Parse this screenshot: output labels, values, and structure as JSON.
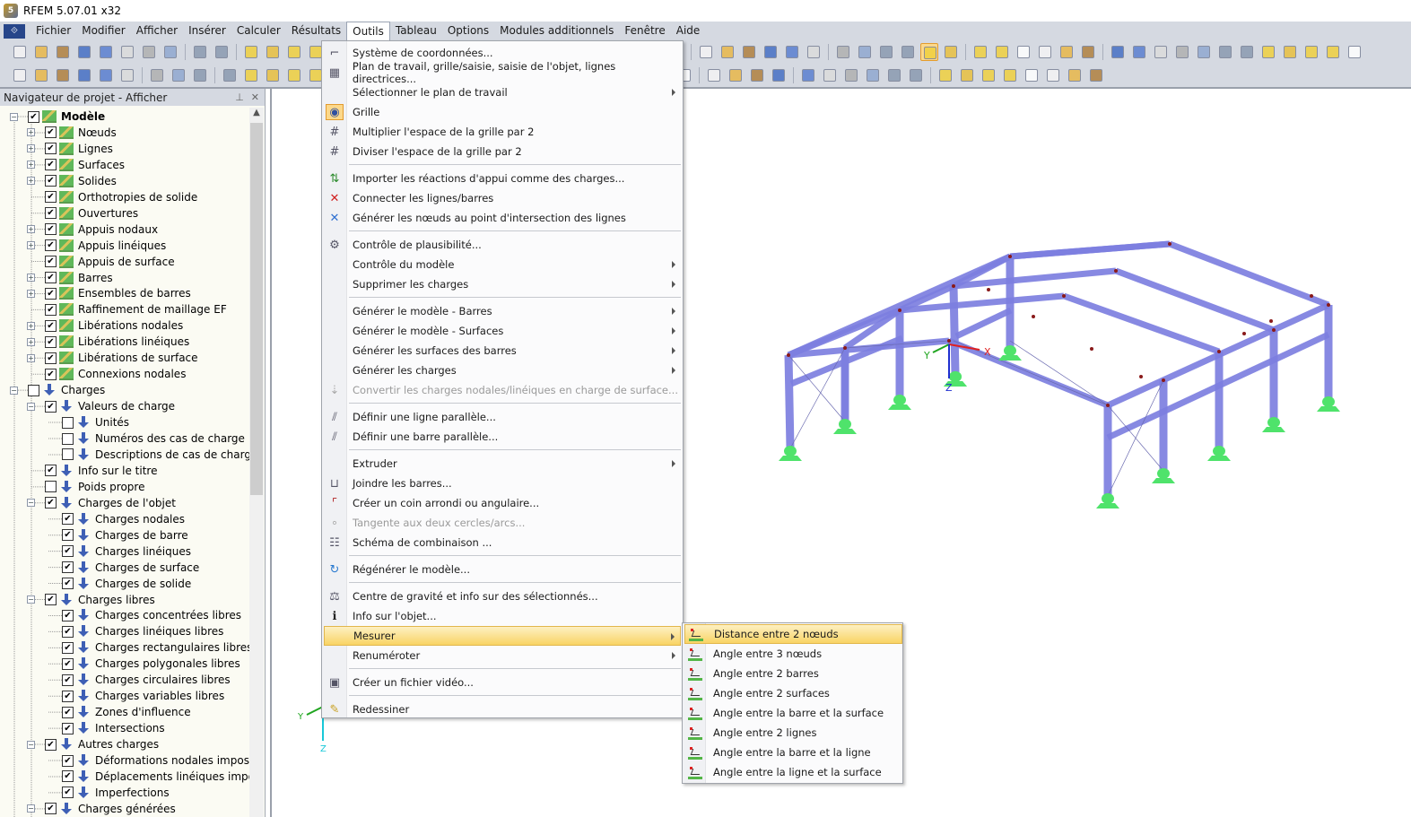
{
  "window": {
    "title": "RFEM 5.07.01 x32"
  },
  "menubar": {
    "items": [
      "Fichier",
      "Modifier",
      "Afficher",
      "Insérer",
      "Calculer",
      "Résultats",
      "Outils",
      "Tableau",
      "Options",
      "Modules additionnels",
      "Fenêtre",
      "Aide"
    ],
    "active": "Outils"
  },
  "navigator": {
    "title": "Navigateur de projet - Afficher",
    "pin_icon": "pin-icon",
    "close_icon": "close-icon",
    "tree": [
      {
        "label": "Modèle",
        "level": 0,
        "expander": "minus",
        "checked": true,
        "icon": "model-icon",
        "bold": true
      },
      {
        "label": "Nœuds",
        "level": 1,
        "expander": "plus",
        "checked": true,
        "icon": "model-icon"
      },
      {
        "label": "Lignes",
        "level": 1,
        "expander": "plus",
        "checked": true,
        "icon": "model-icon"
      },
      {
        "label": "Surfaces",
        "level": 1,
        "expander": "plus",
        "checked": true,
        "icon": "model-icon"
      },
      {
        "label": "Solides",
        "level": 1,
        "expander": "plus",
        "checked": true,
        "icon": "model-icon"
      },
      {
        "label": "Orthotropies de solide",
        "level": 1,
        "expander": "none",
        "checked": true,
        "icon": "model-icon"
      },
      {
        "label": "Ouvertures",
        "level": 1,
        "expander": "none",
        "checked": true,
        "icon": "model-icon"
      },
      {
        "label": "Appuis nodaux",
        "level": 1,
        "expander": "plus",
        "checked": true,
        "icon": "model-icon"
      },
      {
        "label": "Appuis linéiques",
        "level": 1,
        "expander": "plus",
        "checked": true,
        "icon": "model-icon"
      },
      {
        "label": "Appuis de surface",
        "level": 1,
        "expander": "none",
        "checked": true,
        "icon": "model-icon"
      },
      {
        "label": "Barres",
        "level": 1,
        "expander": "plus",
        "checked": true,
        "icon": "model-icon"
      },
      {
        "label": "Ensembles de barres",
        "level": 1,
        "expander": "plus",
        "checked": true,
        "icon": "model-icon"
      },
      {
        "label": "Raffinement de maillage EF",
        "level": 1,
        "expander": "none",
        "checked": true,
        "icon": "model-icon"
      },
      {
        "label": "Libérations nodales",
        "level": 1,
        "expander": "plus",
        "checked": true,
        "icon": "model-icon"
      },
      {
        "label": "Libérations linéiques",
        "level": 1,
        "expander": "plus",
        "checked": true,
        "icon": "model-icon"
      },
      {
        "label": "Libérations de surface",
        "level": 1,
        "expander": "plus",
        "checked": true,
        "icon": "model-icon"
      },
      {
        "label": "Connexions nodales",
        "level": 1,
        "expander": "none",
        "checked": true,
        "icon": "model-icon"
      },
      {
        "label": "Charges",
        "level": 0,
        "expander": "minus",
        "checked": false,
        "icon": "load-icon"
      },
      {
        "label": "Valeurs de charge",
        "level": 1,
        "expander": "minus",
        "checked": true,
        "icon": "load-icon"
      },
      {
        "label": "Unités",
        "level": 2,
        "expander": "none",
        "checked": false,
        "icon": "load-icon"
      },
      {
        "label": "Numéros des cas de charge",
        "level": 2,
        "expander": "none",
        "checked": false,
        "icon": "load-icon"
      },
      {
        "label": "Descriptions de cas de charge",
        "level": 2,
        "expander": "none",
        "checked": false,
        "icon": "load-icon"
      },
      {
        "label": "Info sur le titre",
        "level": 1,
        "expander": "none",
        "checked": true,
        "icon": "load-icon"
      },
      {
        "label": "Poids propre",
        "level": 1,
        "expander": "none",
        "checked": false,
        "icon": "load-icon"
      },
      {
        "label": "Charges de l'objet",
        "level": 1,
        "expander": "minus",
        "checked": true,
        "icon": "load-icon"
      },
      {
        "label": "Charges nodales",
        "level": 2,
        "expander": "none",
        "checked": true,
        "icon": "load-icon"
      },
      {
        "label": "Charges de barre",
        "level": 2,
        "expander": "none",
        "checked": true,
        "icon": "load-icon"
      },
      {
        "label": "Charges linéiques",
        "level": 2,
        "expander": "none",
        "checked": true,
        "icon": "load-icon"
      },
      {
        "label": "Charges de surface",
        "level": 2,
        "expander": "none",
        "checked": true,
        "icon": "load-icon"
      },
      {
        "label": "Charges de solide",
        "level": 2,
        "expander": "none",
        "checked": true,
        "icon": "load-icon"
      },
      {
        "label": "Charges libres",
        "level": 1,
        "expander": "minus",
        "checked": true,
        "icon": "load-icon"
      },
      {
        "label": "Charges concentrées libres",
        "level": 2,
        "expander": "none",
        "checked": true,
        "icon": "load-icon"
      },
      {
        "label": "Charges linéiques libres",
        "level": 2,
        "expander": "none",
        "checked": true,
        "icon": "load-icon"
      },
      {
        "label": "Charges rectangulaires libres",
        "level": 2,
        "expander": "none",
        "checked": true,
        "icon": "load-icon"
      },
      {
        "label": "Charges polygonales libres",
        "level": 2,
        "expander": "none",
        "checked": true,
        "icon": "load-icon"
      },
      {
        "label": "Charges circulaires libres",
        "level": 2,
        "expander": "none",
        "checked": true,
        "icon": "load-icon"
      },
      {
        "label": "Charges variables libres",
        "level": 2,
        "expander": "none",
        "checked": true,
        "icon": "load-icon"
      },
      {
        "label": "Zones d'influence",
        "level": 2,
        "expander": "none",
        "checked": true,
        "icon": "load-icon"
      },
      {
        "label": "Intersections",
        "level": 2,
        "expander": "none",
        "checked": true,
        "icon": "load-icon"
      },
      {
        "label": "Autres charges",
        "level": 1,
        "expander": "minus",
        "checked": true,
        "icon": "load-icon"
      },
      {
        "label": "Déformations nodales imposées",
        "level": 2,
        "expander": "none",
        "checked": true,
        "icon": "load-icon"
      },
      {
        "label": "Déplacements linéiques imposés",
        "level": 2,
        "expander": "none",
        "checked": true,
        "icon": "load-icon"
      },
      {
        "label": "Imperfections",
        "level": 2,
        "expander": "none",
        "checked": true,
        "icon": "load-icon"
      },
      {
        "label": "Charges générées",
        "level": 1,
        "expander": "minus",
        "checked": true,
        "icon": "load-icon"
      }
    ]
  },
  "outils_menu": {
    "groups": [
      [
        {
          "label": "Système de coordonnées...",
          "icon": "coordinate-system-icon"
        },
        {
          "label": "Plan de travail, grille/saisie, saisie de l'objet, lignes directrices...",
          "icon": "work-plane-icon"
        },
        {
          "label": "Sélectionner le plan de travail",
          "icon": "",
          "submenu": true
        },
        {
          "label": "Grille",
          "icon": "grid-icon",
          "checked": true
        },
        {
          "label": "Multiplier l'espace de la grille par 2",
          "icon": "grid-multiply-icon"
        },
        {
          "label": "Diviser l'espace de la grille par 2",
          "icon": "grid-divide-icon"
        }
      ],
      [
        {
          "label": "Importer les réactions d'appui comme des charges...",
          "icon": "import-reactions-icon"
        },
        {
          "label": "Connecter les lignes/barres",
          "icon": "connect-lines-icon"
        },
        {
          "label": "Générer les nœuds au point d'intersection des lignes",
          "icon": "intersection-nodes-icon"
        }
      ],
      [
        {
          "label": "Contrôle de plausibilité...",
          "icon": "plausibility-icon"
        },
        {
          "label": "Contrôle du modèle",
          "icon": "",
          "submenu": true
        },
        {
          "label": "Supprimer les charges",
          "icon": "",
          "submenu": true
        }
      ],
      [
        {
          "label": "Générer le modèle - Barres",
          "icon": "",
          "submenu": true
        },
        {
          "label": "Générer le modèle - Surfaces",
          "icon": "",
          "submenu": true
        },
        {
          "label": "Générer les surfaces des barres",
          "icon": "",
          "submenu": true
        },
        {
          "label": "Générer les charges",
          "icon": "",
          "submenu": true
        },
        {
          "label": "Convertir les charges nodales/linéiques en charge de surface...",
          "icon": "convert-loads-icon",
          "disabled": true
        }
      ],
      [
        {
          "label": "Définir une ligne parallèle...",
          "icon": "parallel-line-icon"
        },
        {
          "label": "Définir une barre parallèle...",
          "icon": "parallel-member-icon"
        }
      ],
      [
        {
          "label": "Extruder",
          "icon": "",
          "submenu": true
        },
        {
          "label": "Joindre les barres...",
          "icon": "join-members-icon"
        },
        {
          "label": "Créer un coin arrondi ou angulaire...",
          "icon": "corner-icon"
        },
        {
          "label": "Tangente aux deux cercles/arcs...",
          "icon": "tangent-icon",
          "disabled": true
        },
        {
          "label": "Schéma de combinaison ...",
          "icon": "combination-scheme-icon"
        }
      ],
      [
        {
          "label": "Régénérer le modèle...",
          "icon": "regenerate-icon"
        }
      ],
      [
        {
          "label": "Centre de gravité et info sur des sélectionnés...",
          "icon": "center-of-gravity-icon"
        },
        {
          "label": "Info sur l'objet...",
          "icon": "info-icon"
        },
        {
          "label": "Mesurer",
          "icon": "",
          "submenu": true,
          "highlighted": true
        },
        {
          "label": "Renuméroter",
          "icon": "",
          "submenu": true
        }
      ],
      [
        {
          "label": "Créer un fichier vidéo...",
          "icon": "video-file-icon"
        }
      ],
      [
        {
          "label": "Redessiner",
          "icon": "pencil-icon"
        }
      ]
    ]
  },
  "mesurer_submenu": {
    "items": [
      {
        "label": "Distance entre 2 nœuds",
        "highlighted": true
      },
      {
        "label": "Angle entre 3 nœuds"
      },
      {
        "label": "Angle entre 2 barres"
      },
      {
        "label": "Angle entre 2 surfaces"
      },
      {
        "label": "Angle entre la barre et la surface"
      },
      {
        "label": "Angle entre 2 lignes"
      },
      {
        "label": "Angle entre la barre et la ligne"
      },
      {
        "label": "Angle entre la ligne et la surface"
      }
    ]
  },
  "viewport": {
    "axes_labels": {
      "x": "X",
      "y": "Y",
      "z": "Z"
    },
    "colors": {
      "member": "#7d7fe0",
      "support": "#4fe36b",
      "x_axis": "#e02020",
      "y_axis": "#1fa51f",
      "z_axis": "#1f2fd0",
      "small_z_axis": "#18c8d8"
    }
  }
}
